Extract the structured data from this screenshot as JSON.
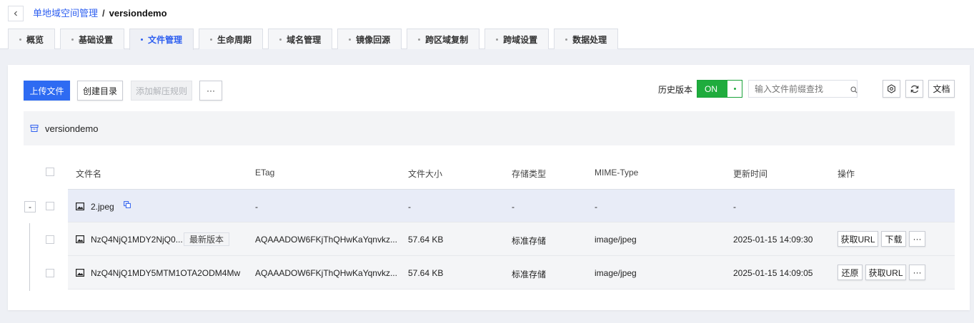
{
  "header": {
    "back_icon": "chevron-left-icon",
    "breadcrumb_parent": "单地域空间管理",
    "breadcrumb_sep": "/",
    "breadcrumb_current": "versiondemo"
  },
  "tabs": [
    {
      "label": "概览"
    },
    {
      "label": "基础设置"
    },
    {
      "label": "文件管理",
      "active": true
    },
    {
      "label": "生命周期"
    },
    {
      "label": "域名管理"
    },
    {
      "label": "镜像回源"
    },
    {
      "label": "跨区域复制"
    },
    {
      "label": "跨域设置"
    },
    {
      "label": "数据处理"
    }
  ],
  "toolbar": {
    "upload": "上传文件",
    "mkdir": "创建目录",
    "unzip_rule": "添加解压规则",
    "more": "···",
    "history_label": "历史版本",
    "toggle_on": "ON",
    "search_placeholder": "输入文件前缀查找",
    "docs": "文档"
  },
  "bucket": {
    "name": "versiondemo"
  },
  "table": {
    "headers": {
      "name": "文件名",
      "etag": "ETag",
      "size": "文件大小",
      "storage": "存储类型",
      "mime": "MIME-Type",
      "updated": "更新时间",
      "ops": "操作"
    },
    "collapse_symbol": "-",
    "rows": [
      {
        "name": "2.jpeg",
        "etag": "-",
        "size": "-",
        "storage": "-",
        "mime": "-",
        "updated": "-"
      },
      {
        "name": "NzQ4NjQ1MDY2NjQ0...",
        "tag": "最新版本",
        "etag": "AQAAADOW6FKjThQHwKaYqnvkz...",
        "size": "57.64 KB",
        "storage": "标准存储",
        "mime": "image/jpeg",
        "updated": "2025-01-15 14:09:30",
        "ops": [
          "获取URL",
          "下载",
          "···"
        ]
      },
      {
        "name": "NzQ4NjQ1MDY5MTM1OTA2ODM4Mw",
        "etag": "AQAAADOW6FKjThQHwKaYqnvkz...",
        "size": "57.64 KB",
        "storage": "标准存储",
        "mime": "image/jpeg",
        "updated": "2025-01-15 14:09:05",
        "ops": [
          "还原",
          "获取URL",
          "···"
        ]
      }
    ]
  },
  "colors": {
    "primary": "#2e6bf2",
    "link": "#2e5ff0",
    "toggle_green": "#1fac3d",
    "page_bg": "#eef0f5"
  }
}
